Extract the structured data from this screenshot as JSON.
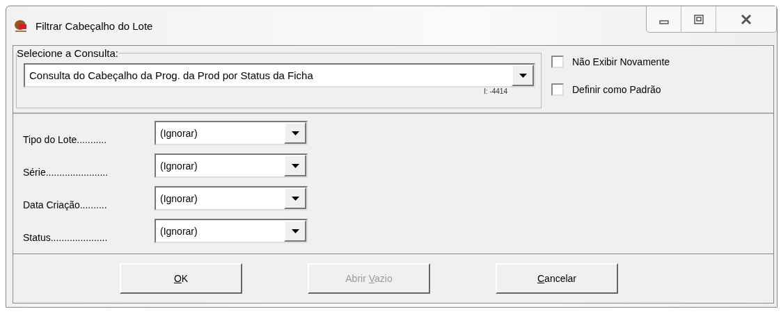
{
  "window": {
    "title": "Filtrar Cabeçalho do Lote"
  },
  "query_group": {
    "legend": "Selecione a Consulta:",
    "query": "Consulta do Cabeçalho da Prog. da Prod por Status da Ficha",
    "code": "I: -4414"
  },
  "options": [
    {
      "label": "Não Exibir Novamente",
      "checked": false
    },
    {
      "label": "Definir como Padrão",
      "checked": false
    }
  ],
  "filters": [
    {
      "label": "Tipo do Lote...........",
      "value": "(Ignorar)"
    },
    {
      "label": "Série.......................",
      "value": "(Ignorar)"
    },
    {
      "label": "Data Criação..........",
      "value": "(Ignorar)"
    },
    {
      "label": "Status.....................",
      "value": "(Ignorar)"
    }
  ],
  "buttons": [
    {
      "key": "O",
      "post": "K",
      "disabled": false
    },
    {
      "pre": "Abrir ",
      "key": "V",
      "post": "azio",
      "disabled": true
    },
    {
      "key": "C",
      "post": "ancelar",
      "disabled": false
    }
  ]
}
